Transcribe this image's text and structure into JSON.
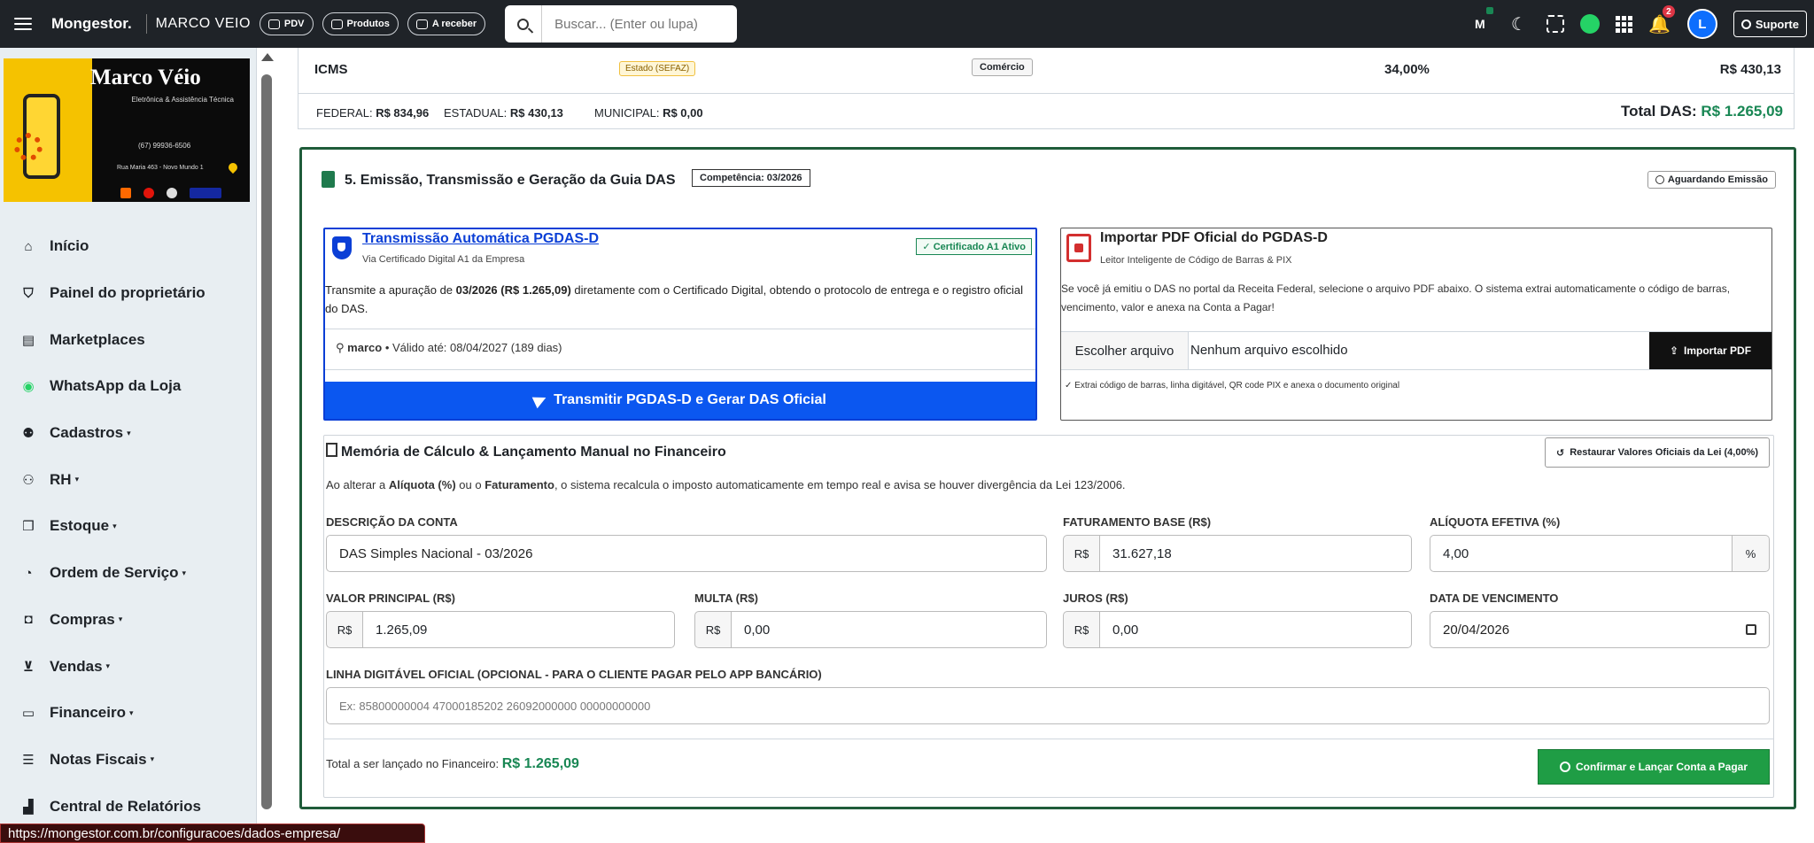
{
  "topbar": {
    "brand": "Mongestor.",
    "company": "MARCO VEIO",
    "pills": [
      {
        "label": "PDV",
        "icon": "cash-register-icon"
      },
      {
        "label": "Produtos",
        "icon": "box-icon"
      },
      {
        "label": "A receber",
        "icon": "money-icon"
      }
    ],
    "search": {
      "placeholder": "Buscar... (Enter ou lupa)"
    },
    "notification_count": "2",
    "avatar_letter": "L",
    "support_label": "Suporte"
  },
  "sidebar": {
    "logo": {
      "title": "Marco Véio",
      "subtitle": "Eletrônica & Assistência Técnica",
      "phone": "(67) 99936-6506",
      "address": "Rua Maria 463 - Novo Mundo 1"
    },
    "items": [
      {
        "label": "Início",
        "icon": "home-icon"
      },
      {
        "label": "Painel do proprietário",
        "icon": "shield-icon"
      },
      {
        "label": "Marketplaces",
        "icon": "store-icon"
      },
      {
        "label": "WhatsApp da Loja",
        "icon": "whatsapp-icon"
      },
      {
        "label": "Cadastros",
        "icon": "users-icon",
        "caret": true
      },
      {
        "label": "RH",
        "icon": "people-icon",
        "caret": true
      },
      {
        "label": "Estoque",
        "icon": "boxes-icon",
        "caret": true
      },
      {
        "label": "Ordem de Serviço",
        "icon": "wrench-icon",
        "caret": true
      },
      {
        "label": "Compras",
        "icon": "bag-icon",
        "caret": true
      },
      {
        "label": "Vendas",
        "icon": "cart-icon",
        "caret": true
      },
      {
        "label": "Financeiro",
        "icon": "wallet-icon",
        "caret": true
      },
      {
        "label": "Notas Fiscais",
        "icon": "document-icon",
        "caret": true
      },
      {
        "label": "Central de Relatórios",
        "icon": "chart-icon"
      }
    ]
  },
  "status_url": "https://mongestor.com.br/configuracoes/dados-empresa/",
  "tax": {
    "icms": {
      "name": "ICMS",
      "scope": "Estado (SEFAZ)",
      "category": "Comércio",
      "percent": "34,00%",
      "value": "R$ 430,13"
    },
    "totals": {
      "federal_label": "FEDERAL:",
      "federal": "R$ 834,96",
      "estadual_label": "ESTADUAL:",
      "estadual": "R$ 430,13",
      "municipal_label": "MUNICIPAL:",
      "municipal": "R$ 0,00",
      "total_label": "Total DAS:",
      "total": "R$ 1.265,09"
    }
  },
  "section": {
    "title": "5. Emissão, Transmissão e Geração da Guia DAS",
    "competencia": "Competência: 03/2026",
    "status": "Aguardando Emissão",
    "transmission": {
      "title": "Transmissão Automática PGDAS-D",
      "subtitle": "Via Certificado Digital A1 da Empresa",
      "cert_badge": "Certificado A1 Ativo",
      "desc_pre": "Transmite a apuração de",
      "desc_period": "03/2026",
      "desc_amount": "(R$ 1.265,09)",
      "desc_post": "diretamente com o Certificado Digital, obtendo o protocolo de entrega e o registro oficial do DAS.",
      "user": "marco",
      "validity": "• Válido até: 08/04/2027 (189 dias)",
      "button": "Transmitir PGDAS-D e Gerar DAS Oficial"
    },
    "import": {
      "title": "Importar PDF Oficial do PGDAS-D",
      "subtitle": "Leitor Inteligente de Código de Barras & PIX",
      "desc": "Se você já emitiu o DAS no portal da Receita Federal, selecione o arquivo PDF abaixo. O sistema extrai automaticamente o código de barras, vencimento, valor e anexa na Conta a Pagar!",
      "choose_file": "Escolher arquivo",
      "no_file": "Nenhum arquivo escolhido",
      "button": "Importar PDF",
      "note": "✓ Extrai código de barras, linha digitável, QR code PIX e anexa o documento original"
    },
    "memory": {
      "title": "Memória de Cálculo & Lançamento Manual no Financeiro",
      "restore": "Restaurar Valores Oficiais da Lei (4,00%)",
      "info_pre": "Ao alterar a",
      "info_b1": "Alíquota (%)",
      "info_mid": "ou o",
      "info_b2": "Faturamento",
      "info_post": ", o sistema recalcula o imposto automaticamente em tempo real e avisa se houver divergência da Lei 123/2006.",
      "fields": {
        "descricao_label": "Descrição da Conta",
        "descricao": "DAS Simples Nacional - 03/2026",
        "faturamento_label": "Faturamento Base (R$)",
        "faturamento": "31.627,18",
        "aliquota_label": "Alíquota Efetiva (%)",
        "aliquota": "4,00",
        "principal_label": "Valor Principal (R$)",
        "principal": "1.265,09",
        "multa_label": "Multa (R$)",
        "multa": "0,00",
        "juros_label": "Juros (R$)",
        "juros": "0,00",
        "vencimento_label": "Data de Vencimento",
        "vencimento": "20/04/2026",
        "linha_label": "Linha Digitável Oficial (Opcional - Para o cliente pagar pelo app bancário)",
        "linha_placeholder": "Ex: 85800000004 47000185202 26092000000 00000000000",
        "currency_prefix": "R$",
        "percent_suffix": "%"
      },
      "total_label": "Total a ser lançado no Financeiro:",
      "total": "R$ 1.265,09",
      "confirm": "Confirmar e Lançar Conta a Pagar"
    }
  }
}
